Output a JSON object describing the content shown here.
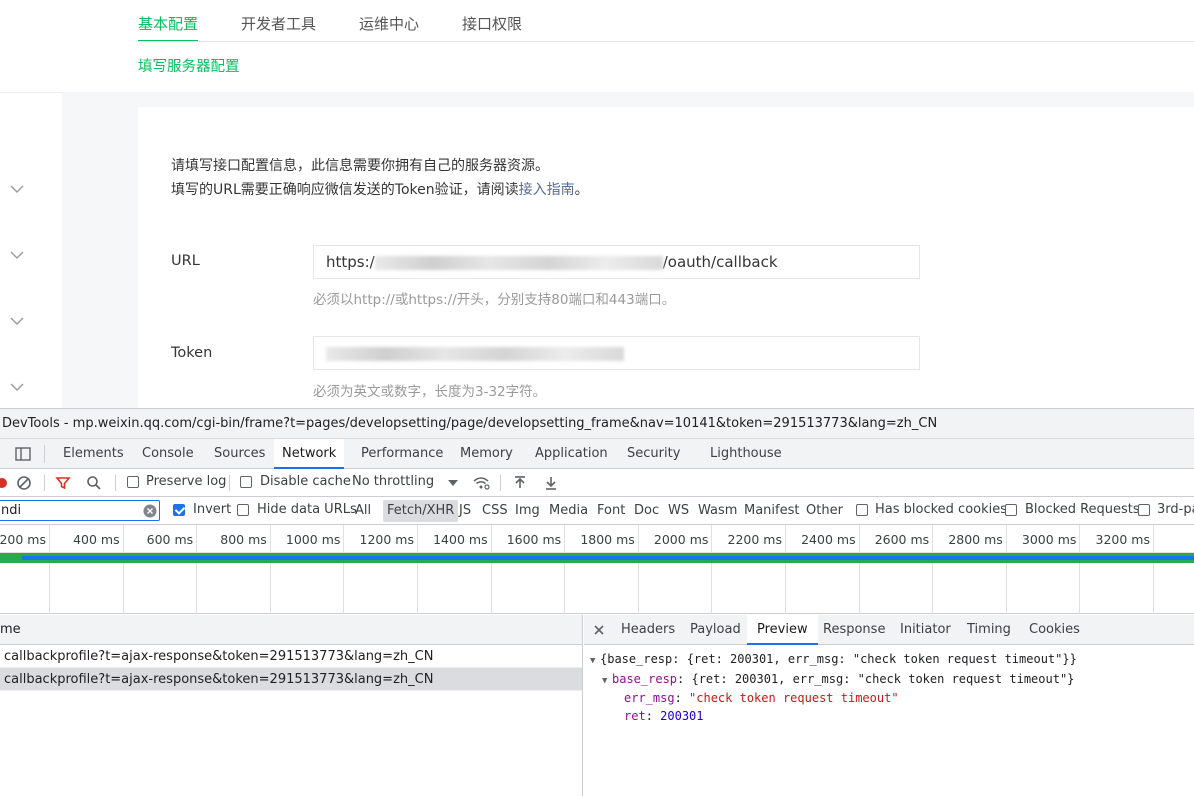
{
  "page": {
    "tabs": [
      {
        "label": "基本配置",
        "active": true
      },
      {
        "label": "开发者工具",
        "active": false
      },
      {
        "label": "运维中心",
        "active": false
      },
      {
        "label": "接口权限",
        "active": false
      }
    ],
    "subtitle": "填写服务器配置",
    "desc_line1": "请填写接口配置信息，此信息需要你拥有自己的服务器资源。",
    "desc_line2_prefix": "填写的URL需要正确响应微信发送的Token验证，请阅读",
    "desc_line2_link": "接入指南",
    "desc_line2_suffix": "。",
    "url_label": "URL",
    "url_prefix": "https:/",
    "url_suffix": "/oauth/callback",
    "url_hint": "必须以http://或https://开头，分别支持80端口和443端口。",
    "token_label": "Token",
    "token_hint": "必须为英文或数字，长度为3-32字符。",
    "accent_color": "#07c160"
  },
  "devtools": {
    "title": "DevTools - mp.weixin.qq.com/cgi-bin/frame?t=pages/developsetting/page/developsetting_frame&nav=10141&token=291513773&lang=zh_CN",
    "tabs": [
      "Elements",
      "Console",
      "Sources",
      "Network",
      "Performance",
      "Memory",
      "Application",
      "Security",
      "Lighthouse"
    ],
    "active_tab": "Network",
    "toolbar": {
      "preserve_log": "Preserve log",
      "disable_cache": "Disable cache",
      "throttling": "No throttling"
    },
    "filter": {
      "value": "ndi",
      "invert": "Invert",
      "hide_data_urls": "Hide data URLs",
      "types": [
        "All",
        "Fetch/XHR",
        "JS",
        "CSS",
        "Img",
        "Media",
        "Font",
        "Doc",
        "WS",
        "Wasm",
        "Manifest",
        "Other"
      ],
      "active_type": "Fetch/XHR",
      "has_blocked_cookies": "Has blocked cookies",
      "blocked_requests": "Blocked Requests",
      "third_party": "3rd-pa"
    },
    "timeline_ticks": [
      "200 ms",
      "400 ms",
      "600 ms",
      "800 ms",
      "1000 ms",
      "1200 ms",
      "1400 ms",
      "1600 ms",
      "1800 ms",
      "2000 ms",
      "2200 ms",
      "2400 ms",
      "2600 ms",
      "2800 ms",
      "3000 ms",
      "3200 ms",
      "340"
    ],
    "requests_header": "me",
    "requests": [
      {
        "name": "callbackprofile?t=ajax-response&token=291513773&lang=zh_CN",
        "selected": false
      },
      {
        "name": "callbackprofile?t=ajax-response&token=291513773&lang=zh_CN",
        "selected": true
      }
    ],
    "detail_tabs": [
      "Headers",
      "Payload",
      "Preview",
      "Response",
      "Initiator",
      "Timing",
      "Cookies"
    ],
    "active_detail_tab": "Preview",
    "preview": {
      "line1": "{base_resp: {ret: 200301, err_msg: \"check token request timeout\"}}",
      "line2_key": "base_resp",
      "line2_val": "{ret: 200301, err_msg: \"check token request timeout\"}",
      "line3_key": "err_msg",
      "line3_val": "\"check token request timeout\"",
      "line4_key": "ret",
      "line4_val": "200301"
    }
  }
}
